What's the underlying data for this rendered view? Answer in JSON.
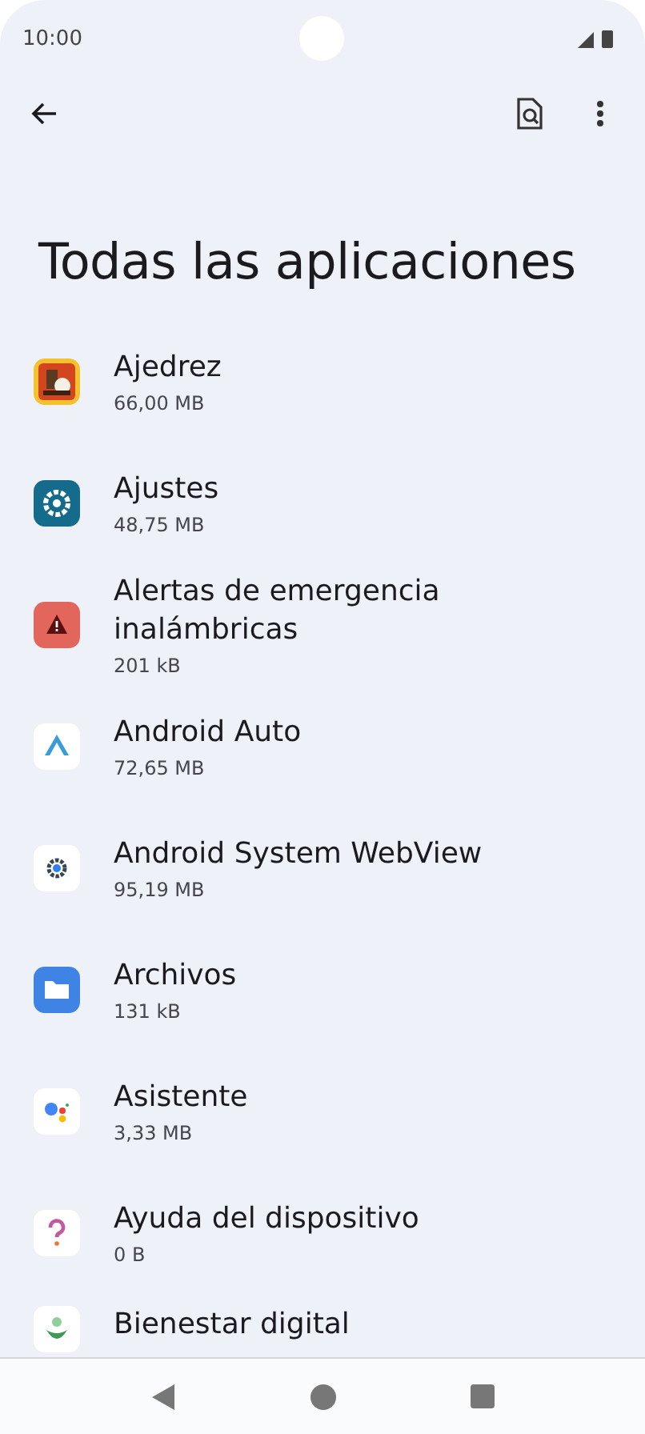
{
  "status_bar": {
    "time": "10:00"
  },
  "title": "Todas las aplicaciones",
  "apps": [
    {
      "name": "Ajedrez",
      "size": "66,00 MB",
      "kind": "chess"
    },
    {
      "name": "Ajustes",
      "size": "48,75 MB",
      "kind": "settings"
    },
    {
      "name": "Alertas de emergencia inalámbricas",
      "size": "201 kB",
      "kind": "alert"
    },
    {
      "name": "Android Auto",
      "size": "72,65 MB",
      "kind": "auto"
    },
    {
      "name": "Android System WebView",
      "size": "95,19 MB",
      "kind": "webview"
    },
    {
      "name": "Archivos",
      "size": "131 kB",
      "kind": "files"
    },
    {
      "name": "Asistente",
      "size": "3,33 MB",
      "kind": "assistant"
    },
    {
      "name": "Ayuda del dispositivo",
      "size": "0 B",
      "kind": "help"
    },
    {
      "name": "Bienestar digital",
      "kind": "wellbeing"
    }
  ]
}
